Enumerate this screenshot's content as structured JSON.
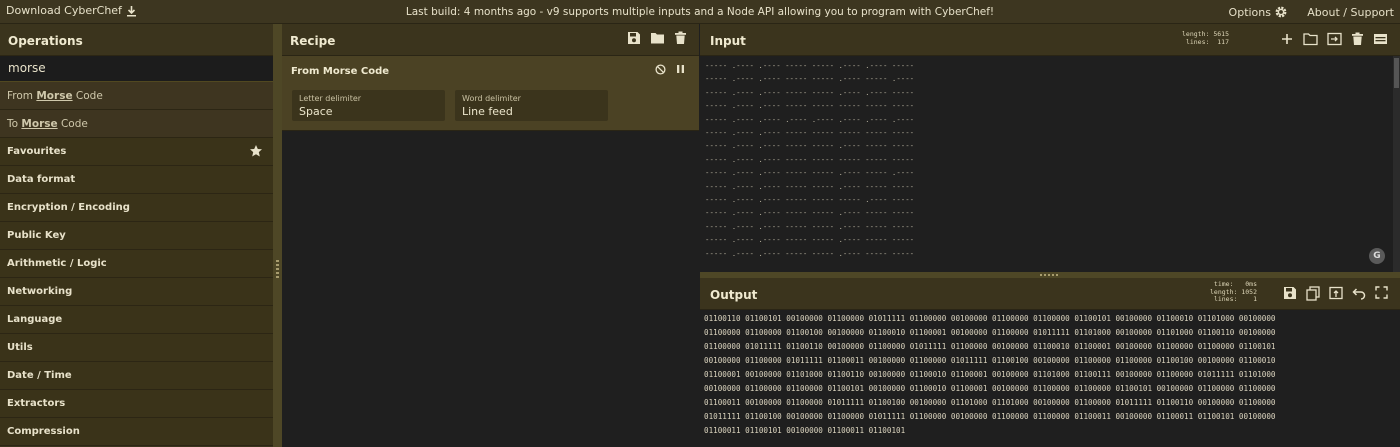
{
  "banner": {
    "download_label": "Download CyberChef",
    "message": "Last build: 4 months ago - v9 supports multiple inputs and a Node API allowing you to program with CyberChef!",
    "options_label": "Options",
    "about_label": "About / Support"
  },
  "operations": {
    "title": "Operations",
    "search_value": "morse",
    "results": [
      {
        "prefix": "From ",
        "match": "Morse",
        "suffix": " Code"
      },
      {
        "prefix": "To ",
        "match": "Morse",
        "suffix": " Code"
      }
    ],
    "categories": [
      "Favourites",
      "Data format",
      "Encryption / Encoding",
      "Public Key",
      "Arithmetic / Logic",
      "Networking",
      "Language",
      "Utils",
      "Date / Time",
      "Extractors",
      "Compression"
    ]
  },
  "recipe": {
    "title": "Recipe",
    "operation": {
      "name": "From Morse Code",
      "letter_delimiter_label": "Letter delimiter",
      "letter_delimiter_value": "Space",
      "word_delimiter_label": "Word delimiter",
      "word_delimiter_value": "Line feed"
    }
  },
  "input": {
    "title": "Input",
    "length_label": "length:",
    "length_value": "5615",
    "lines_label": "lines:",
    "lines_value": "117",
    "lines": [
      "----- .---- .---- ----- ----- .---- .---- -----",
      "----- .---- .---- ----- ----- .---- ----- .----",
      "----- .---- .---- ----- ----- .---- .---- -----",
      "----- .---- .---- ----- ----- ----- ----- -----",
      "----- .---- .---- .---- .---- .---- .---- .----",
      "----- .---- .---- ----- ----- ----- ----- -----",
      "----- .---- .---- ----- ----- .---- ----- -----",
      "----- .---- .---- ----- ----- ----- ----- -----",
      "----- .---- .---- ----- ----- .---- ----- .----",
      "----- .---- .---- ----- ----- .---- ----- -----",
      "----- .---- .---- ----- ----- ----- .---- -----",
      "----- .---- .---- ----- ----- .---- ----- -----",
      "----- .---- .---- ----- ----- .---- ----- -----",
      "----- .---- .---- ----- ----- .---- ----- -----",
      "----- .---- .---- ----- ----- .---- ----- -----"
    ]
  },
  "output": {
    "title": "Output",
    "time_label": "time:",
    "time_value": "0ms",
    "length_label": "length:",
    "length_value": "1052",
    "lines_label": "lines:",
    "lines_value": "1",
    "lines": [
      "01100110 01100101 00100000 01100000 01011111 01100000 00100000 01100000 01100000 01100101 00100000 01100010 01101000 00100000",
      "01100000 01100000 01100100 00100000 01100010 01100001 00100000 01100000 01011111 01101000 00100000 01101000 01100110 00100000",
      "01100000 01011111 01100110 00100000 01100000 01011111 01100000 00100000 01100010 01100001 00100000 01100000 01100000 01100101",
      "00100000 01100000 01011111 01100011 00100000 01100000 01011111 01100100 00100000 01100000 01100000 01100100 00100000 01100010",
      "01100001 00100000 01101000 01100110 00100000 01100010 01100001 00100000 01101000 01100111 00100000 01100000 01011111 01101000",
      "00100000 01100000 01100000 01100101 00100000 01100010 01100001 00100000 01100000 01100000 01100101 00100000 01100000 01100000",
      "01100011 00100000 01100000 01011111 01100100 00100000 01101000 01101000 00100000 01100000 01011111 01100110 00100000 01100000",
      "01011111 01100100 00100000 01100000 01011111 01100000 00100000 01100000 01100000 01100011 00100000 01100011 01100101 00100000",
      "01100011 01100101 00100000 01100011 01100101"
    ]
  },
  "colors": {
    "banner": "#3d3620",
    "panel_header": "#3b341d",
    "accent_text": "#f0ead0",
    "editor_bg": "#1f1f1f"
  },
  "icons": [
    "download-icon",
    "gear-icon",
    "star-icon",
    "save-icon",
    "folder-icon",
    "trash-icon",
    "disable-icon",
    "pause-icon",
    "plus-icon",
    "import-icon",
    "layout-icon",
    "copy-icon",
    "replace-input-icon",
    "undo-icon",
    "maximise-icon"
  ]
}
